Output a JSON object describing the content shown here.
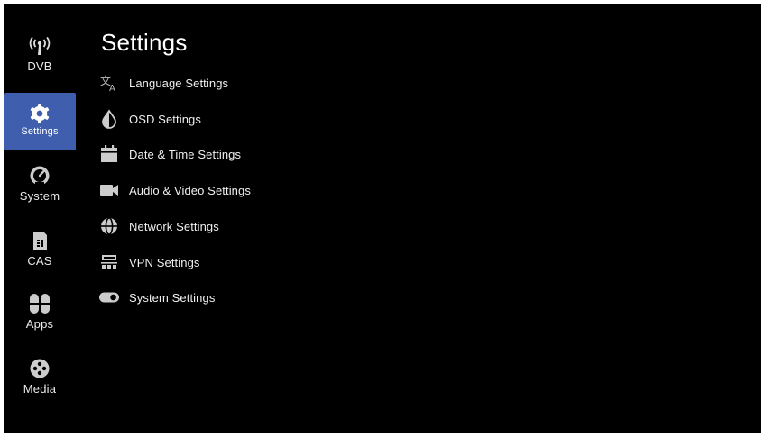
{
  "header": {
    "title": "Settings"
  },
  "sidebar": {
    "active_color": "#3f5fae",
    "items": [
      {
        "label": "DVB",
        "icon": "antenna-broadcast-icon"
      },
      {
        "label": "Settings",
        "icon": "gear-icon",
        "active": true
      },
      {
        "label": "System",
        "icon": "gauge-icon"
      },
      {
        "label": "CAS",
        "icon": "sim-card-icon"
      },
      {
        "label": "Apps",
        "icon": "apps-grid-icon"
      },
      {
        "label": "Media",
        "icon": "film-reel-icon"
      }
    ]
  },
  "menu": {
    "items": [
      {
        "label": "Language Settings",
        "icon": "translate-icon"
      },
      {
        "label": "OSD Settings",
        "icon": "contrast-drop-icon"
      },
      {
        "label": "Date & Time Settings",
        "icon": "calendar-icon"
      },
      {
        "label": "Audio & Video Settings",
        "icon": "video-camera-icon"
      },
      {
        "label": "Network Settings",
        "icon": "globe-icon"
      },
      {
        "label": "VPN Settings",
        "icon": "network-tree-icon"
      },
      {
        "label": "System Settings",
        "icon": "toggle-icon"
      }
    ]
  }
}
